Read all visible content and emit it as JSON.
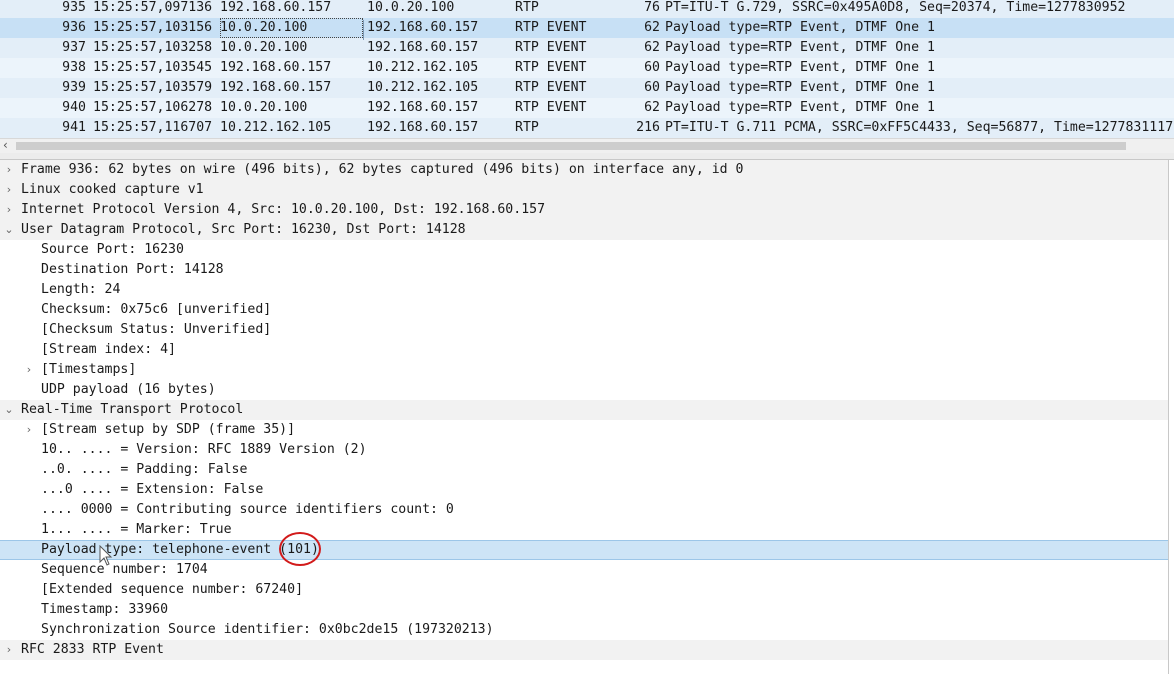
{
  "packets": [
    {
      "no": "935",
      "time": "15:25:57,097136",
      "src": "192.168.60.157",
      "dst": "10.0.20.100",
      "proto": "RTP",
      "len": "76",
      "info": "PT=ITU-T G.729, SSRC=0x495A0D8, Seq=20374, Time=1277830952"
    },
    {
      "no": "936",
      "time": "15:25:57,103156",
      "src": "10.0.20.100",
      "dst": "192.168.60.157",
      "proto": "RTP EVENT",
      "len": "62",
      "info": "Payload type=RTP Event, DTMF One 1"
    },
    {
      "no": "937",
      "time": "15:25:57,103258",
      "src": "10.0.20.100",
      "dst": "192.168.60.157",
      "proto": "RTP EVENT",
      "len": "62",
      "info": "Payload type=RTP Event, DTMF One 1"
    },
    {
      "no": "938",
      "time": "15:25:57,103545",
      "src": "192.168.60.157",
      "dst": "10.212.162.105",
      "proto": "RTP EVENT",
      "len": "60",
      "info": "Payload type=RTP Event, DTMF One 1"
    },
    {
      "no": "939",
      "time": "15:25:57,103579",
      "src": "192.168.60.157",
      "dst": "10.212.162.105",
      "proto": "RTP EVENT",
      "len": "60",
      "info": "Payload type=RTP Event, DTMF One 1"
    },
    {
      "no": "940",
      "time": "15:25:57,106278",
      "src": "10.0.20.100",
      "dst": "192.168.60.157",
      "proto": "RTP EVENT",
      "len": "62",
      "info": "Payload type=RTP Event, DTMF One 1"
    },
    {
      "no": "941",
      "time": "15:25:57,116707",
      "src": "10.212.162.105",
      "dst": "192.168.60.157",
      "proto": "RTP",
      "len": "216",
      "info": "PT=ITU-T G.711 PCMA, SSRC=0xFF5C4433, Seq=56877, Time=1277831117"
    }
  ],
  "selected_packet": "936",
  "details": [
    {
      "level": 0,
      "expander": "›",
      "text": "Frame 936: 62 bytes on wire (496 bits), 62 bytes captured (496 bits) on interface any, id 0"
    },
    {
      "level": 0,
      "expander": "›",
      "text": "Linux cooked capture v1"
    },
    {
      "level": 0,
      "expander": "›",
      "text": "Internet Protocol Version 4, Src: 10.0.20.100, Dst: 192.168.60.157"
    },
    {
      "level": 0,
      "expander": "⌄",
      "text": "User Datagram Protocol, Src Port: 16230, Dst Port: 14128"
    },
    {
      "level": 1,
      "expander": "",
      "text": "Source Port: 16230"
    },
    {
      "level": 1,
      "expander": "",
      "text": "Destination Port: 14128"
    },
    {
      "level": 1,
      "expander": "",
      "text": "Length: 24"
    },
    {
      "level": 1,
      "expander": "",
      "text": "Checksum: 0x75c6 [unverified]"
    },
    {
      "level": 1,
      "expander": "",
      "text": "[Checksum Status: Unverified]"
    },
    {
      "level": 1,
      "expander": "",
      "text": "[Stream index: 4]"
    },
    {
      "level": 1,
      "expander": "›",
      "text": "[Timestamps]"
    },
    {
      "level": 1,
      "expander": "",
      "text": "UDP payload (16 bytes)"
    },
    {
      "level": 0,
      "expander": "⌄",
      "text": "Real-Time Transport Protocol"
    },
    {
      "level": 1,
      "expander": "›",
      "text": "[Stream setup by SDP (frame 35)]"
    },
    {
      "level": 1,
      "expander": "",
      "text": "10.. .... = Version: RFC 1889 Version (2)"
    },
    {
      "level": 1,
      "expander": "",
      "text": "..0. .... = Padding: False"
    },
    {
      "level": 1,
      "expander": "",
      "text": "...0 .... = Extension: False"
    },
    {
      "level": 1,
      "expander": "",
      "text": ".... 0000 = Contributing source identifiers count: 0"
    },
    {
      "level": 1,
      "expander": "",
      "text": "1... .... = Marker: True"
    },
    {
      "level": 1,
      "expander": "",
      "text": "Payload type: telephone-event (101)"
    },
    {
      "level": 1,
      "expander": "",
      "text": "Sequence number: 1704"
    },
    {
      "level": 1,
      "expander": "",
      "text": "[Extended sequence number: 67240]"
    },
    {
      "level": 1,
      "expander": "",
      "text": "Timestamp: 33960"
    },
    {
      "level": 1,
      "expander": "",
      "text": "Synchronization Source identifier: 0x0bc2de15 (197320213)"
    },
    {
      "level": 0,
      "expander": "›",
      "text": "RFC 2833 RTP Event"
    }
  ],
  "highlighted_detail_index": 19,
  "annotation": {
    "color": "#d21a1a",
    "target": "101"
  },
  "scroll_left_icon": "chevron-left-icon"
}
